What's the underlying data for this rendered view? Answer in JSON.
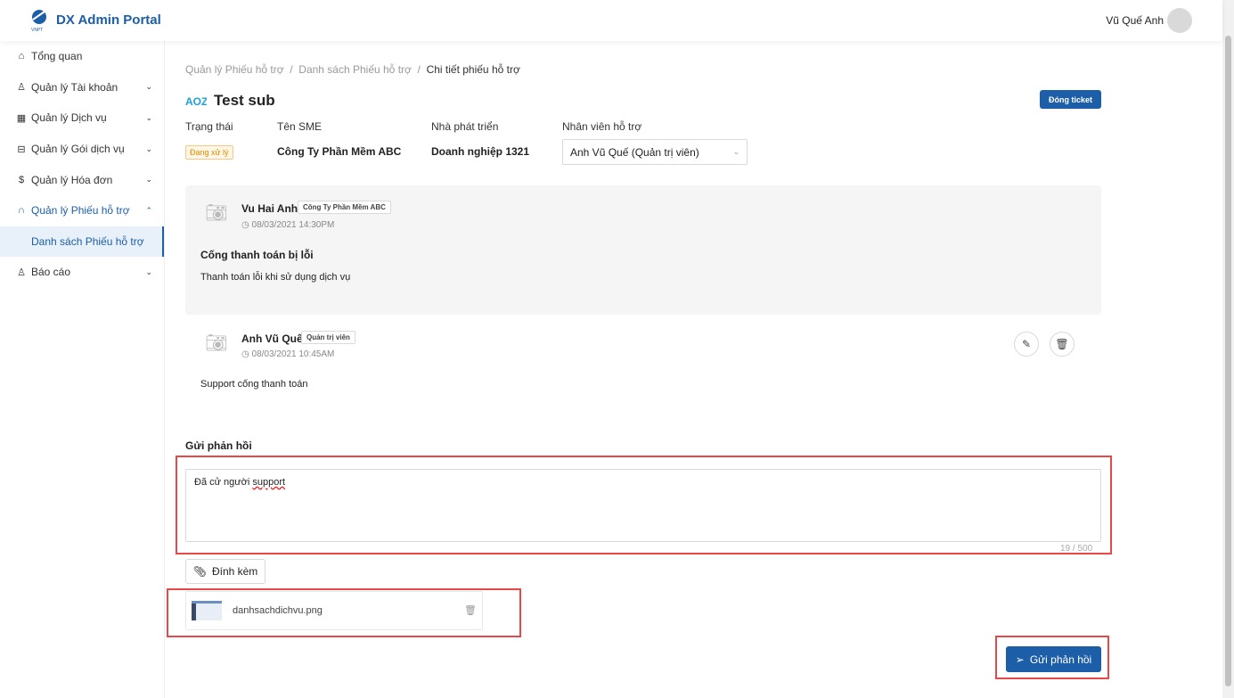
{
  "app": {
    "title": "DX Admin Portal",
    "logo_text": "VNPT",
    "user_name": "Vũ Quế Anh"
  },
  "sidebar": {
    "items": [
      {
        "label": "Tổng quan",
        "icon": "home-icon"
      },
      {
        "label": "Quản lý Tài khoản",
        "icon": "user-icon"
      },
      {
        "label": "Quản lý Dịch vụ",
        "icon": "grid-icon"
      },
      {
        "label": "Quản lý Gói dịch vụ",
        "icon": "package-icon"
      },
      {
        "label": "Quản lý Hóa đơn",
        "icon": "dollar-icon"
      },
      {
        "label": "Quản lý Phiếu hỗ trợ",
        "icon": "headset-icon"
      },
      {
        "label": "Danh sách Phiếu hỗ trợ"
      },
      {
        "label": "Báo cáo",
        "icon": "user-icon"
      }
    ]
  },
  "breadcrumb": [
    "Quản lý Phiếu hỗ trợ",
    "Danh sách Phiếu hỗ trợ",
    "Chi tiết phiếu hỗ trợ"
  ],
  "ticket": {
    "title": "Test sub",
    "close_label": "Đóng ticket",
    "fields": {
      "status_label": "Trạng thái",
      "status": "Đang xử lý",
      "sme_label": "Tên SME",
      "sme": "Công Ty Phần Mềm ABC",
      "dev_label": "Nhà phát triển",
      "dev": "Doanh nghiệp 1321",
      "staff_label": "Nhân viên hỗ trợ",
      "staff": "Anh Vũ Quế (Quản trị viên)"
    }
  },
  "messages": [
    {
      "author": "Vu Hai Anh",
      "tag": "Công Ty Phần Mềm ABC",
      "time": "08/03/2021 14:30PM",
      "subject": "Cống thanh toán bị lỗi",
      "body": "Thanh toán lỗi khi sử dụng dịch vụ"
    },
    {
      "author": "Anh Vũ Quế",
      "tag": "Quản trị viên",
      "time": "08/03/2021 10:45AM",
      "body": "Support cống thanh toán"
    }
  ],
  "reply": {
    "label": "Gửi phản hồi",
    "text_prefix": "Đã cử người ",
    "text_word": "support",
    "count": "19 / 500",
    "attach_label": "Đính kèm",
    "file": "danhsachdichvu.png",
    "send_label": "Gửi phản hồi"
  },
  "colors": {
    "primary": "#1c5ea8",
    "highlight": "#e84848"
  }
}
